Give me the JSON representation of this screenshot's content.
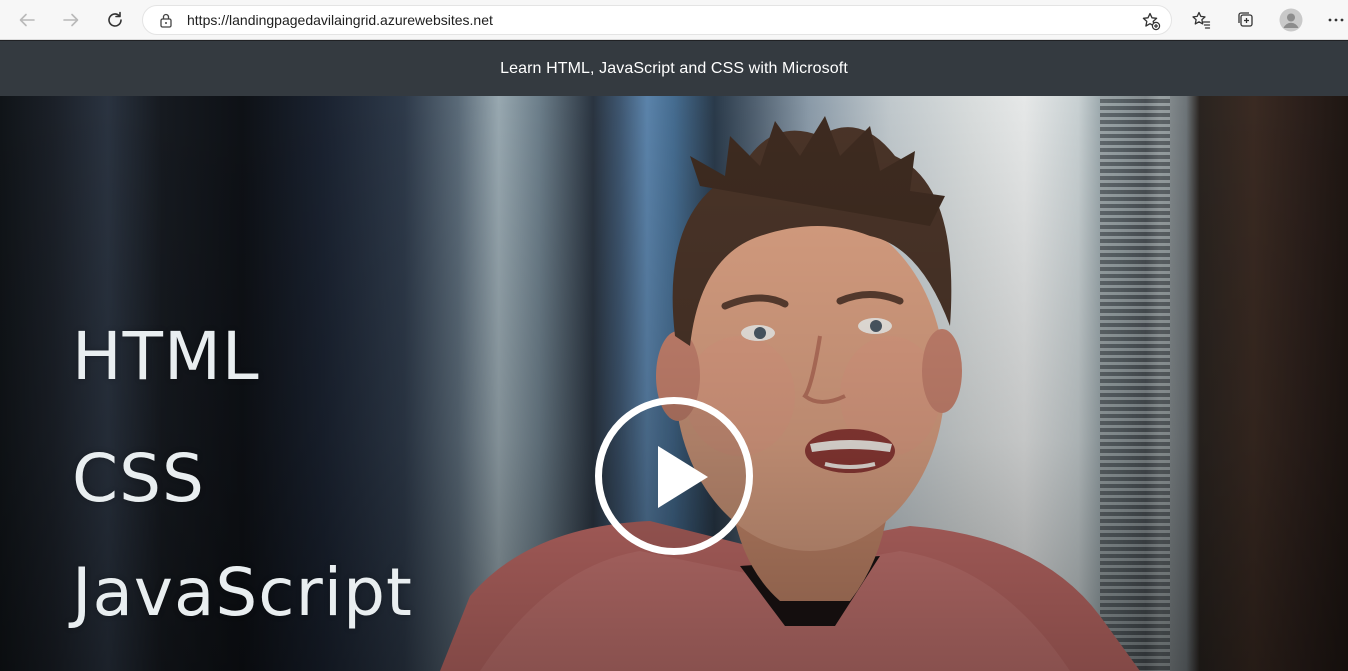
{
  "browser": {
    "url": "https://landingpagedavilaingrid.azurewebsites.net",
    "icons": {
      "back": "arrow-left-icon",
      "forward": "arrow-right-icon",
      "refresh": "refresh-icon",
      "lock": "lock-icon",
      "add_favorite": "star-add-icon",
      "favorites": "favorites-icon",
      "collections": "collections-icon",
      "profile": "profile-icon",
      "menu": "ellipsis-icon"
    }
  },
  "header": {
    "title": "Learn HTML, JavaScript and CSS with Microsoft",
    "background": "#343a40"
  },
  "video": {
    "caption_lines": [
      "HTML",
      "CSS",
      "JavaScript"
    ],
    "play_icon": "play-icon"
  }
}
